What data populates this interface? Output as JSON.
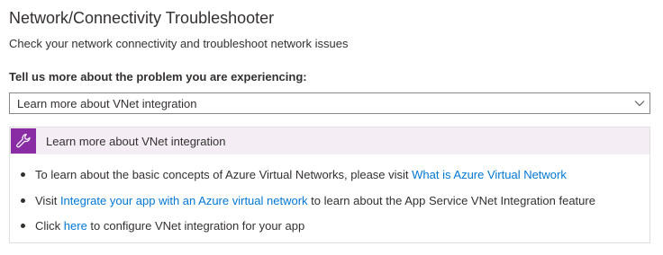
{
  "header": {
    "title": "Network/Connectivity Troubleshooter",
    "subtitle": "Check your network connectivity and troubleshoot network issues"
  },
  "form": {
    "question": "Tell us more about the problem you are experiencing:",
    "selected_option": "Learn more about VNet integration"
  },
  "panel": {
    "title": "Learn more about VNet integration",
    "icon": "wrench-icon",
    "icon_bg": "#8a2da5",
    "items": [
      {
        "text_before": "To learn about the basic concepts of Azure Virtual Networks, please visit ",
        "link": "What is Azure Virtual Network",
        "text_after": ""
      },
      {
        "text_before": "Visit ",
        "link": "Integrate your app with an Azure virtual network",
        "text_after": " to learn about the App Service VNet Integration feature"
      },
      {
        "text_before": "Click ",
        "link": "here",
        "text_after": " to configure VNet integration for your app"
      }
    ]
  },
  "colors": {
    "link": "#0078d4",
    "text": "#323130",
    "panel_header_bg": "#f4eef4"
  }
}
